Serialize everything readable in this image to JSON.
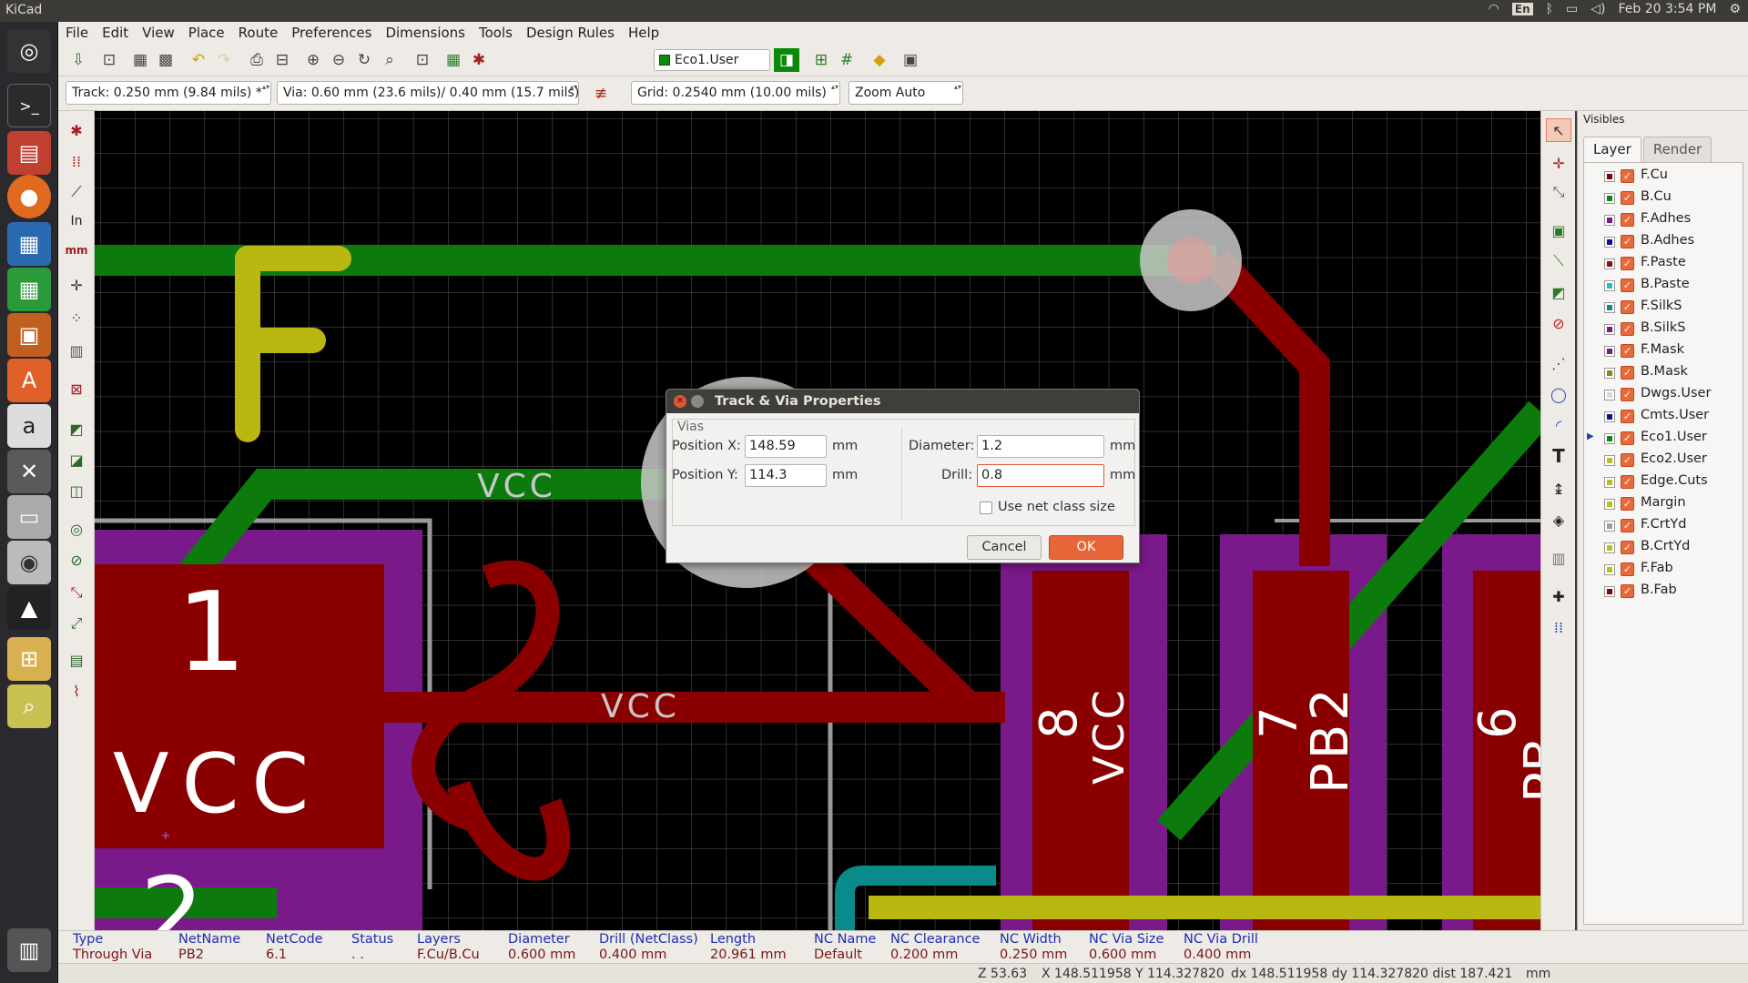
{
  "system": {
    "app_title": "KiCad",
    "lang": "En",
    "clock": "Feb 20  3:54 PM"
  },
  "menu": [
    "File",
    "Edit",
    "View",
    "Place",
    "Route",
    "Preferences",
    "Dimensions",
    "Tools",
    "Design Rules",
    "Help"
  ],
  "toolbar": {
    "active_layer": "Eco1.User",
    "active_layer_color": "#0a8a0a"
  },
  "aux_toolbar": {
    "track": "Track: 0.250 mm (9.84 mils) *",
    "via": "Via: 0.60 mm (23.6 mils)/ 0.40 mm (15.7 mils) *",
    "grid": "Grid: 0.2540 mm (10.00 mils)",
    "zoom": "Zoom Auto"
  },
  "left_tools": {
    "units_in": "In",
    "units_mm": "mm"
  },
  "canvas": {
    "labels": {
      "vcc_top": "VCC",
      "vcc_mid": "VCC",
      "f_glyph": "F",
      "pad1": "1",
      "pad1_net": "VCC",
      "pad2": "2",
      "pin8": "8",
      "pin8_net": "VCC",
      "pin7": "7",
      "pin7_net": "PB2",
      "pin6": "6",
      "pin6_net": "PB"
    },
    "colors": {
      "track_green": "#0d7a0d",
      "track_red": "#8a0000",
      "silk_yellow": "#b8b811",
      "pad_purple": "#7a1a8a",
      "background": "#000000"
    }
  },
  "visibles": {
    "header": "Visibles",
    "tabs": [
      "Layer",
      "Render"
    ],
    "active_tab": "Layer",
    "layers": [
      {
        "name": "F.Cu",
        "color": "#8a0000",
        "active": false
      },
      {
        "name": "B.Cu",
        "color": "#0a8a0a",
        "active": false
      },
      {
        "name": "F.Adhes",
        "color": "#7a1a8a",
        "active": false
      },
      {
        "name": "B.Adhes",
        "color": "#10108a",
        "active": false
      },
      {
        "name": "F.Paste",
        "color": "#8a1010",
        "active": false
      },
      {
        "name": "B.Paste",
        "color": "#22c0c0",
        "active": false
      },
      {
        "name": "F.SilkS",
        "color": "#0a8a8a",
        "active": false
      },
      {
        "name": "B.SilkS",
        "color": "#7a1a8a",
        "active": false
      },
      {
        "name": "F.Mask",
        "color": "#7a1a8a",
        "active": false
      },
      {
        "name": "B.Mask",
        "color": "#8a8a10",
        "active": false
      },
      {
        "name": "Dwgs.User",
        "color": "#d8d8d8",
        "active": false
      },
      {
        "name": "Cmts.User",
        "color": "#10108a",
        "active": false
      },
      {
        "name": "Eco1.User",
        "color": "#0a8a0a",
        "active": true
      },
      {
        "name": "Eco2.User",
        "color": "#c0c010",
        "active": false
      },
      {
        "name": "Edge.Cuts",
        "color": "#c0c010",
        "active": false
      },
      {
        "name": "Margin",
        "color": "#c0c010",
        "active": false
      },
      {
        "name": "F.CrtYd",
        "color": "#a0a0a0",
        "active": false
      },
      {
        "name": "B.CrtYd",
        "color": "#c0c010",
        "active": false
      },
      {
        "name": "F.Fab",
        "color": "#c0c010",
        "active": false
      },
      {
        "name": "B.Fab",
        "color": "#8a0000",
        "active": false
      }
    ]
  },
  "message_panel": [
    {
      "key": "Type",
      "value": "Through Via"
    },
    {
      "key": "NetName",
      "value": "PB2"
    },
    {
      "key": "NetCode",
      "value": "6.1"
    },
    {
      "key": "Status",
      "value": ". ."
    },
    {
      "key": "Layers",
      "value": "F.Cu/B.Cu"
    },
    {
      "key": "Diameter",
      "value": "0.600 mm"
    },
    {
      "key": "Drill (NetClass)",
      "value": "0.400 mm"
    },
    {
      "key": "Length",
      "value": "20.961 mm"
    },
    {
      "key": "NC Name",
      "value": "Default"
    },
    {
      "key": "NC Clearance",
      "value": "0.200 mm"
    },
    {
      "key": "NC Width",
      "value": "0.250 mm"
    },
    {
      "key": "NC Via Size",
      "value": "0.600 mm"
    },
    {
      "key": "NC Via Drill",
      "value": "0.400 mm"
    }
  ],
  "status_bar": {
    "zoom": "Z 53.63",
    "abs": "X 148.511958  Y 114.327820",
    "rel": "dx 148.511958  dy 114.327820  dist 187.421",
    "units": "mm"
  },
  "dialog": {
    "title": "Track & Via Properties",
    "group": "Vias",
    "pos_x_label": "Position X:",
    "pos_x": "148.59",
    "pos_y_label": "Position Y:",
    "pos_y": "114.3",
    "diameter_label": "Diameter:",
    "diameter": "1.2",
    "drill_label": "Drill:",
    "drill": "0.8",
    "unit": "mm",
    "use_netclass": "Use net class size",
    "cancel": "Cancel",
    "ok": "OK"
  }
}
